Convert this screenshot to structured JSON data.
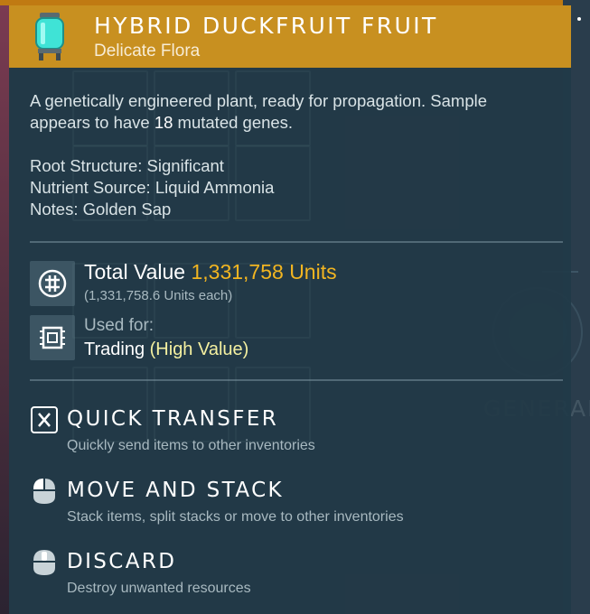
{
  "item": {
    "title": "HYBRID DUCKFRUIT FRUIT",
    "subtitle": "Delicate Flora",
    "icon": "specimen-jar-icon"
  },
  "description": {
    "line1": "A genetically engineered plant, ready for propagation. Sample",
    "line2_prefix": "appears to have ",
    "mutated_genes": "18",
    "line2_suffix": " mutated genes."
  },
  "stats": [
    "Root Structure: Significant",
    "Nutrient Source: Liquid Ammonia",
    "Notes: Golden Sap"
  ],
  "value": {
    "label": "Total Value",
    "amount": "1,331,758 Units",
    "each": "(1,331,758.6 Units each)",
    "icon": "units-currency-icon"
  },
  "used_for": {
    "label": "Used for:",
    "value": "Trading",
    "qualifier": "(High Value)",
    "icon": "chip-icon"
  },
  "actions": [
    {
      "title": "QUICK TRANSFER",
      "description": "Quickly send items to other inventories",
      "icon": "x-key-icon"
    },
    {
      "title": "MOVE AND STACK",
      "description": "Stack items, split stacks or move to other inventories",
      "icon": "mouse-left-icon"
    },
    {
      "title": "DISCARD",
      "description": "Destroy unwanted resources",
      "icon": "mouse-middle-icon"
    }
  ],
  "background": {
    "tab_label": "GENERAL"
  },
  "colors": {
    "header_bg": "#c89020",
    "panel_bg": "#213a48",
    "value_gold": "#f2b521",
    "highlight_yellow": "#f4f0a0"
  }
}
